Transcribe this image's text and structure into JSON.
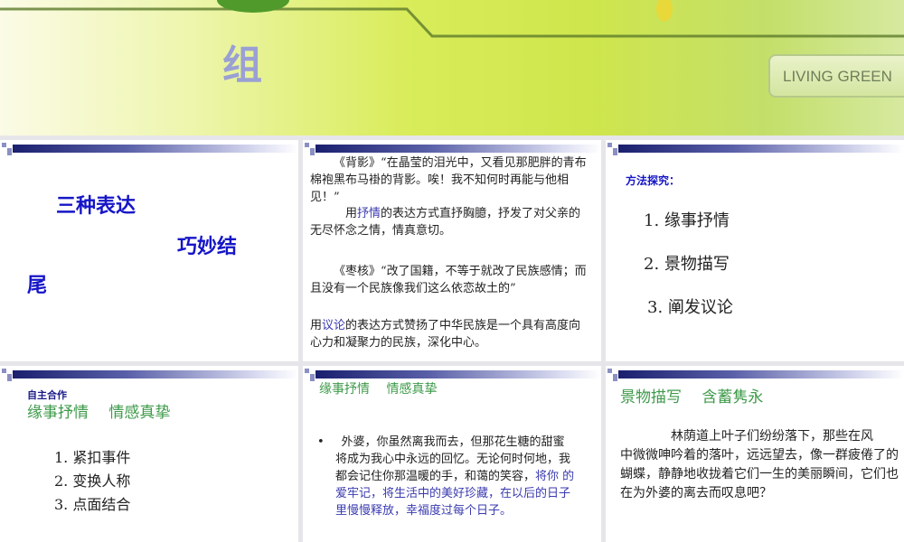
{
  "banner": {
    "title_char": "组",
    "badge": "LIVING GREEN"
  },
  "slides": [
    {
      "lines": [
        "三种表达",
        "巧妙结",
        "尾"
      ]
    },
    {
      "p1": "《背影》“在晶莹的泪光中，又看见那肥胖的青布棉袍黑布马褂的背影。唉！我不知何时再能与他相见！”",
      "p2a": "用",
      "p2b": "抒情",
      "p2c": "的表达方式直抒胸臆，抒发了对父亲的无尽怀念之情，情真意切。",
      "p3": "《枣核》“改了国籍，不等于就改了民族感情；而且没有一个民族像我们这么依恋故土的”",
      "p4a": "用",
      "p4b": "议论",
      "p4c": "的表达方式赞扬了中华民族是一个具有高度向心力和凝聚力的民族，深化中心。"
    },
    {
      "title": "方法探究：",
      "items": [
        "1. 缘事抒情",
        "2. 景物描写",
        "3. 阐发议论"
      ]
    },
    {
      "label": "自主合作",
      "subtitle": "缘事抒情　 情感真挚",
      "items": [
        "1.  紧扣事件",
        "2. 变换人称",
        "3.  点面结合"
      ]
    },
    {
      "title": "缘事抒情　 情感真挚",
      "bullet": "•",
      "text_a": "外婆，你虽然离我而去，但那花生糖的甜蜜将成为我心中永远的回忆。无论何时何地，我都会记住你那温暖的手，和蔼的笑容，",
      "text_b": "将你 的爱牢记，将生活中的美好珍藏，在以后的日子里慢慢释放，幸福度过每个日子。"
    },
    {
      "title": "景物描写　 含蓄隽永",
      "text": "林荫道上叶子们纷纷落下，那些在风　　中微微呻吟着的落叶，远远望去，像一群疲倦了的蝴蝶，静静地收拢着它们一生的美丽瞬间，它们也在为外婆的离去而叹息吧？"
    }
  ]
}
